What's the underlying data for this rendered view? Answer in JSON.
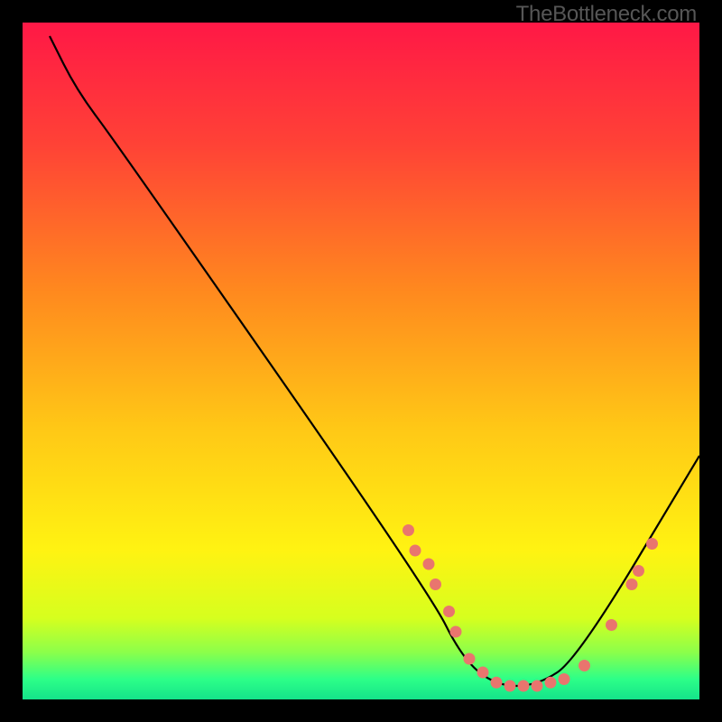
{
  "watermark": "TheBottleneck.com",
  "chart_data": {
    "type": "line",
    "title": "",
    "xlabel": "",
    "ylabel": "",
    "x_range": [
      0,
      100
    ],
    "y_range": [
      0,
      100
    ],
    "curve": {
      "description": "V-shaped bottleneck curve with minimum near x≈70",
      "points": [
        {
          "x": 4,
          "y": 98
        },
        {
          "x": 8,
          "y": 90
        },
        {
          "x": 14,
          "y": 82
        },
        {
          "x": 60,
          "y": 16
        },
        {
          "x": 65,
          "y": 6
        },
        {
          "x": 70,
          "y": 2
        },
        {
          "x": 76,
          "y": 2
        },
        {
          "x": 82,
          "y": 6
        },
        {
          "x": 100,
          "y": 36
        }
      ]
    },
    "markers": [
      {
        "x": 57,
        "y": 25
      },
      {
        "x": 58,
        "y": 22
      },
      {
        "x": 60,
        "y": 20
      },
      {
        "x": 61,
        "y": 17
      },
      {
        "x": 63,
        "y": 13
      },
      {
        "x": 64,
        "y": 10
      },
      {
        "x": 66,
        "y": 6
      },
      {
        "x": 68,
        "y": 4
      },
      {
        "x": 70,
        "y": 2.5
      },
      {
        "x": 72,
        "y": 2
      },
      {
        "x": 74,
        "y": 2
      },
      {
        "x": 76,
        "y": 2
      },
      {
        "x": 78,
        "y": 2.5
      },
      {
        "x": 80,
        "y": 3
      },
      {
        "x": 83,
        "y": 5
      },
      {
        "x": 87,
        "y": 11
      },
      {
        "x": 90,
        "y": 17
      },
      {
        "x": 91,
        "y": 19
      },
      {
        "x": 93,
        "y": 23
      }
    ],
    "gradient_stops": [
      {
        "offset": 0.0,
        "color": "#ff1846"
      },
      {
        "offset": 0.18,
        "color": "#ff4236"
      },
      {
        "offset": 0.4,
        "color": "#ff8a1e"
      },
      {
        "offset": 0.6,
        "color": "#ffc816"
      },
      {
        "offset": 0.78,
        "color": "#fff312"
      },
      {
        "offset": 0.88,
        "color": "#d6ff1e"
      },
      {
        "offset": 0.93,
        "color": "#8cff4a"
      },
      {
        "offset": 0.97,
        "color": "#2dff88"
      },
      {
        "offset": 1.0,
        "color": "#14e38a"
      }
    ],
    "marker_color": "#e9756e",
    "line_color": "#000000"
  }
}
